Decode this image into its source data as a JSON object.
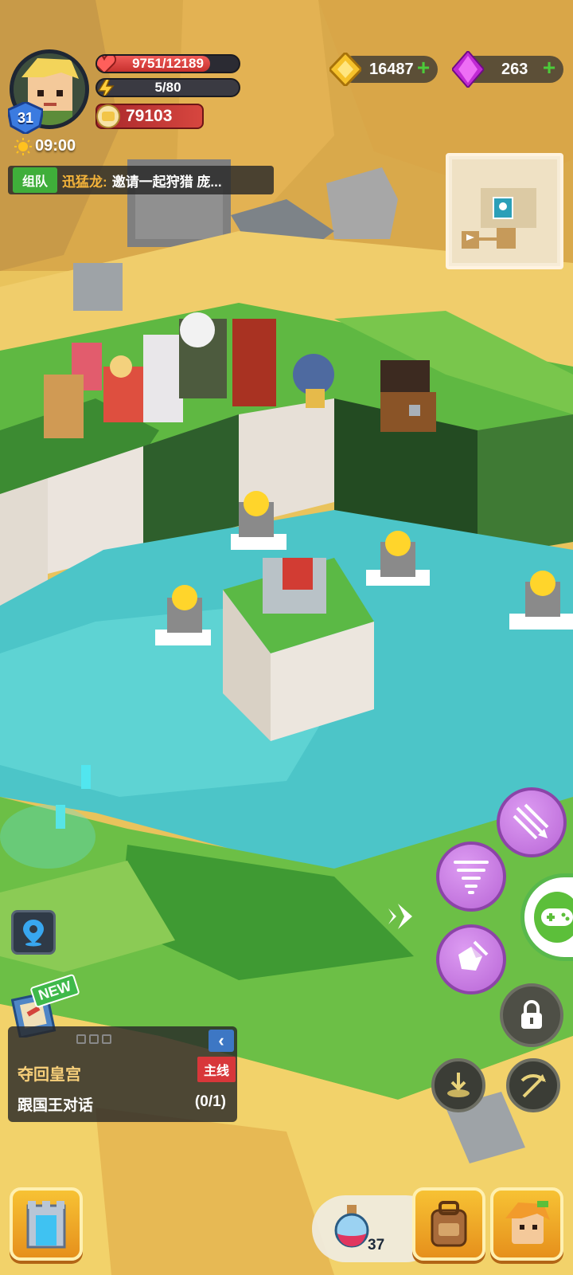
{
  "player": {
    "level": "31",
    "hp": "9751/12189",
    "hp_fraction": 0.8,
    "energy": "5/80",
    "energy_fraction": 0.0625,
    "power": "79103",
    "time": "09:00"
  },
  "currency": {
    "gold": "16487",
    "gems": "263"
  },
  "chat": {
    "tag": "组队",
    "sender": "迅猛龙:",
    "message": "邀请一起狩猎 庞..."
  },
  "quest": {
    "title": "夺回皇宫",
    "type_badge": "主线",
    "task": "跟国王对话",
    "progress": "(0/1)",
    "new_label": "NEW"
  },
  "inventory": {
    "potion_count": "37"
  },
  "colors": {
    "skill_purple": "#c57de0",
    "hp_red": "#e04542",
    "gold_yellow": "#f3b23a",
    "quest_badge_red": "#d8373a",
    "action_green": "#5cbf3a"
  },
  "icons": [
    "heart-icon",
    "lightning-icon",
    "power-fist-icon",
    "sun-clock-icon",
    "gold-coin-icon",
    "purple-gem-icon",
    "plus-icon",
    "map-pin-icon",
    "volley-arrows-skill-icon",
    "whirlwind-skill-icon",
    "shatter-skill-icon",
    "gamepad-icon",
    "lock-icon",
    "dodge-icon",
    "crossbow-icon",
    "dungeon-portal-icon",
    "backpack-icon",
    "hero-portrait-icon",
    "health-potion-icon",
    "collapse-chevron-icon"
  ]
}
